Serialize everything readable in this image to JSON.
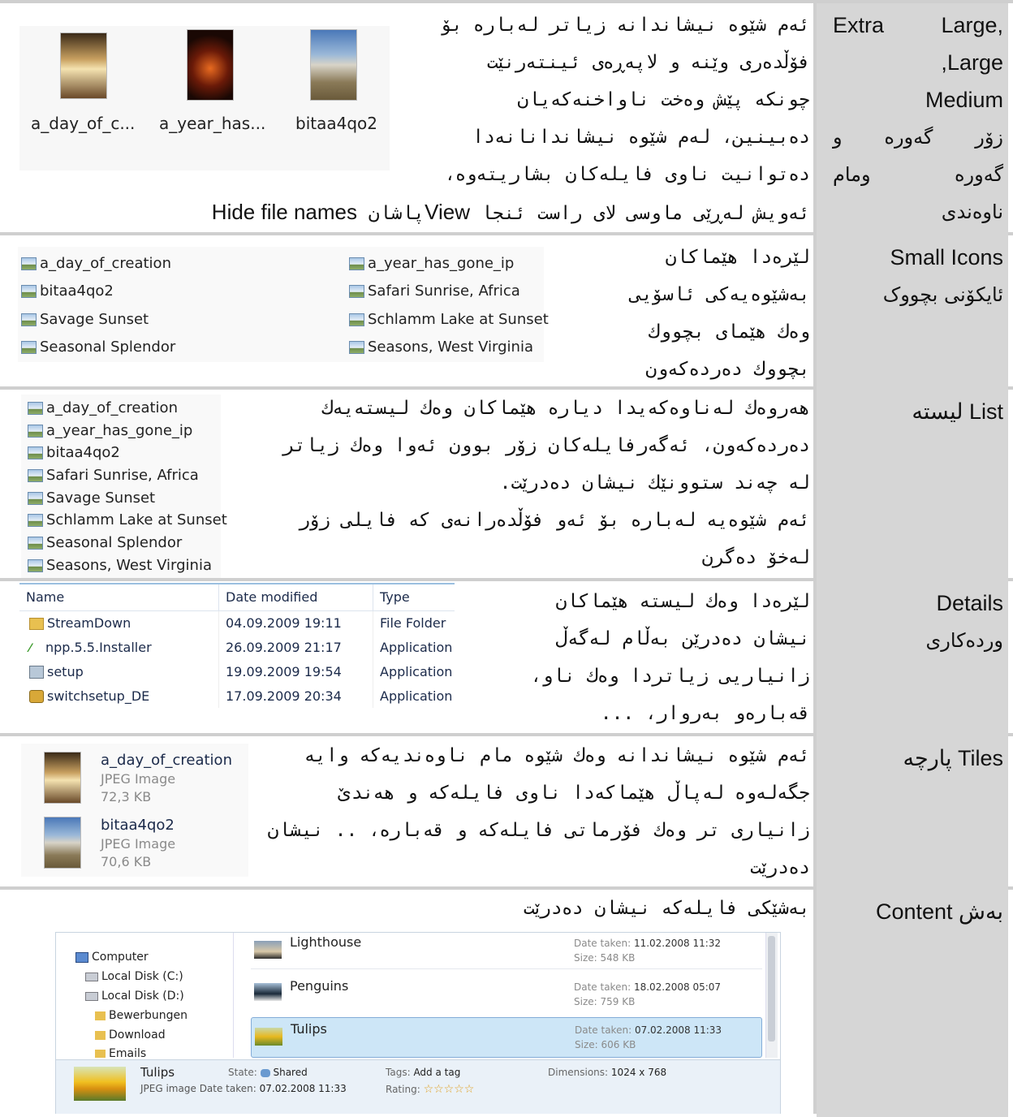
{
  "rows": [
    {
      "label_lines": [
        "Extra Large,",
        "Large,",
        "Medium",
        "زۆر گەورە و",
        "گەورە ومام",
        "ناوەندی"
      ],
      "desc_lines": [
        "ئەم شێوە نیشاندانە زیاتر لەبارە بۆ",
        "فۆڵدەری وێنە و لاپەڕەی ئینتەرنێت",
        "چونکە پێش وەخت ناواخنەکەیان",
        "دەبینین، لەم شێوە نیشاندانانەدا",
        "دەتوانیت ناوی فایلەکان بشاریتەوە،"
      ],
      "desc_last": {
        "a": "ئەویش لەڕێی ماوسی لای راست ئنجا",
        "view": "View",
        "b": "پاشان",
        "hide": "Hide file names"
      },
      "thumbs": [
        "a_day_of_c...",
        "a_year_has...",
        "bitaa4qo2"
      ]
    },
    {
      "label_lines": [
        "Small Icons",
        "ئایکۆنی بچووک"
      ],
      "desc_lines": [
        "لێرەدا هێماکان",
        "بەشێوەیەکی ئاسۆیی",
        "وەك هێمای بچووك",
        "بچووك دەردەکەون"
      ],
      "items_left": [
        "a_day_of_creation",
        "bitaa4qo2",
        "Savage Sunset",
        "Seasonal Splendor"
      ],
      "items_right": [
        "a_year_has_gone_ip",
        "Safari Sunrise, Africa",
        "Schlamm Lake at Sunset",
        "Seasons, West Virginia"
      ]
    },
    {
      "label": "List لیستە",
      "desc_lines": [
        "هەروەك لەناوەکەیدا دیارە هێماکان وەك لیستەیەك",
        "دەردەکەون، ئەگەرفایلەکان زۆر بوون ئەوا وەك زیاتر",
        "لە چەند ستوونێك نیشان دەدرێت.",
        "ئەم شێوەیە لەبارە بۆ ئەو فۆڵدەرانەی کە فایلی زۆر",
        "لەخۆ دەگرن"
      ],
      "items": [
        "a_day_of_creation",
        "a_year_has_gone_ip",
        "bitaa4qo2",
        "Safari Sunrise, Africa",
        "Savage Sunset",
        "Schlamm Lake at Sunset",
        "Seasonal Splendor",
        "Seasons, West Virginia"
      ]
    },
    {
      "label_lines": [
        "Details",
        "وردەکاری"
      ],
      "desc_lines": [
        "لێرەدا وەك لیستە هێماکان",
        "نیشان دەدرێن بەڵام لەگەڵ",
        "زانیاریی زیاتردا وەك ناو،",
        "قەبارەو بەروار، ..."
      ],
      "columns": [
        "Name",
        "Date modified",
        "Type"
      ],
      "files": [
        {
          "name": "StreamDown",
          "date": "04.09.2009 19:11",
          "type": "File Folder"
        },
        {
          "name": "npp.5.5.Installer",
          "date": "26.09.2009 21:17",
          "type": "Application"
        },
        {
          "name": "setup",
          "date": "19.09.2009 19:54",
          "type": "Application"
        },
        {
          "name": "switchsetup_DE",
          "date": "17.09.2009 20:34",
          "type": "Application"
        }
      ]
    },
    {
      "label": "Tiles پارچە",
      "desc_lines": [
        "ئەم شێوە نیشاندانە وەك شێوە مام ناوەندیەکە وایە",
        "جگەلەوە لەپاڵ هێماکەدا ناوی فایلەکە و هەندێ",
        "زانیاری تر وەك فۆرماتی فایلەکە و قەبارە، .. نیشان",
        "دەدرێت"
      ],
      "tiles": [
        {
          "name": "a_day_of_creation",
          "type": "JPEG Image",
          "size": "72,3 KB"
        },
        {
          "name": "bitaa4qo2",
          "type": "JPEG Image",
          "size": "70,6 KB"
        }
      ]
    },
    {
      "label": "بەش Content",
      "desc": "بەشێکی فایلەکە نیشان دەدرێت",
      "tree": [
        "Computer",
        "Local Disk (C:)",
        "Local Disk (D:)",
        "Bewerbungen",
        "Download",
        "Emails"
      ],
      "content_items": [
        {
          "name": "Lighthouse",
          "date_label": "Date taken:",
          "date": "11.02.2008 11:32",
          "size_label": "Size:",
          "size": "548 KB"
        },
        {
          "name": "Penguins",
          "date_label": "Date taken:",
          "date": "18.02.2008 05:07",
          "size_label": "Size:",
          "size": "759 KB"
        },
        {
          "name": "Tulips",
          "date_label": "Date taken:",
          "date": "07.02.2008 11:33",
          "size_label": "Size:",
          "size": "606 KB"
        }
      ],
      "details_pane": {
        "name": "Tulips",
        "kind": "JPEG image",
        "date_label": "Date taken:",
        "date": "07.02.2008 11:33",
        "state_label": "State:",
        "state": "Shared",
        "tags_label": "Tags:",
        "tags": "Add a tag",
        "rating_label": "Rating:",
        "dim_label": "Dimensions:",
        "dim": "1024 x 768"
      }
    }
  ],
  "colors": {
    "label_bg": "#d6d6d6",
    "separator": "#cfcfcf",
    "selection": "#cde6f7"
  }
}
